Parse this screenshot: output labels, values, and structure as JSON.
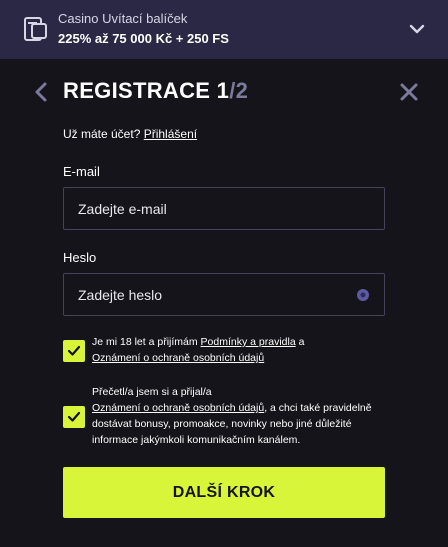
{
  "banner": {
    "subtitle": "Casino Uvítací balíček",
    "title": "225% až 75 000 Kč + 250 FS",
    "icon": "gift-card-icon"
  },
  "header": {
    "title": "REGISTRACE",
    "step": "1",
    "separator": "/",
    "total": "2"
  },
  "account": {
    "prompt": "Už máte účet?",
    "login_link": "Přihlášení"
  },
  "email": {
    "label": "E-mail",
    "placeholder": "Zadejte e-mail"
  },
  "password": {
    "label": "Heslo",
    "placeholder": "Zadejte heslo"
  },
  "consents": {
    "terms": {
      "checked": true,
      "text_before": "Je mi 18 let a přijímám ",
      "link1": "Podmínky a pravidla",
      "text_mid": " a",
      "link2": "Oznámení o ochraně osobních údajů"
    },
    "marketing": {
      "checked": true,
      "text_before": "Přečetl/a jsem si a přijal/a",
      "link": "Oznámení o ochraně osobních údajů",
      "text_after": ", a chci také pravidelně dostávat bonusy, promoakce, novinky nebo jiné důležité informace jakýmkoli komunikačním kanálem."
    }
  },
  "cta": {
    "label": "DALŠÍ KROK"
  },
  "colors": {
    "background": "#14141a",
    "banner": "#2b2845",
    "accent": "#d8f53a",
    "muted": "#7c7a9c"
  }
}
